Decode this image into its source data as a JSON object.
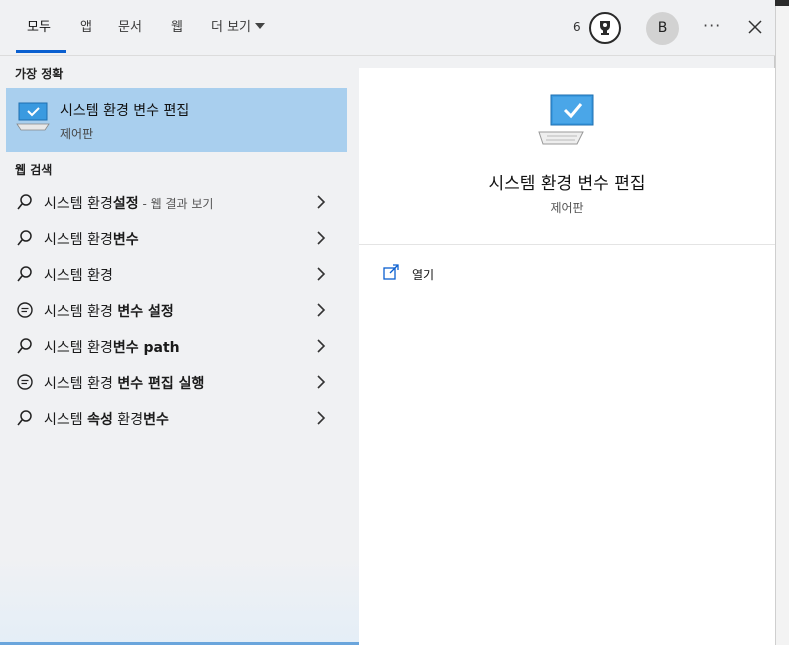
{
  "tabs": [
    {
      "label": "모두"
    },
    {
      "label": "앱"
    },
    {
      "label": "문서"
    },
    {
      "label": "웹"
    },
    {
      "label": "더 보기"
    }
  ],
  "header": {
    "points": "6",
    "avatar_initial": "B",
    "more_label": "···"
  },
  "sections": {
    "best_match": "가장 정확",
    "web_search": "웹 검색"
  },
  "best_match": {
    "title": "시스템 환경 변수 편집",
    "subtitle": "제어판"
  },
  "results": [
    {
      "icon": "search-icon",
      "normal": "시스템 환경",
      "bold": "설정",
      "suffix": " - 웹 결과 보기"
    },
    {
      "icon": "search-icon",
      "normal": "시스템 환경",
      "bold": "변수",
      "suffix": ""
    },
    {
      "icon": "search-icon",
      "normal": "시스템 환경",
      "bold": "",
      "suffix": ""
    },
    {
      "icon": "chat-icon",
      "normal": "시스템 환경 ",
      "bold": "변수 설정",
      "suffix": ""
    },
    {
      "icon": "search-icon",
      "normal": "시스템 환경",
      "bold": "변수 path",
      "suffix": ""
    },
    {
      "icon": "chat-icon",
      "normal": "시스템 환경 ",
      "bold": "변수 편집 실행",
      "suffix": ""
    },
    {
      "icon": "search-icon",
      "normal": "시스템 ",
      "bold": "속성",
      "mid": " 환경",
      "bold2": "변수",
      "suffix": ""
    }
  ],
  "detail": {
    "title": "시스템 환경 변수 편집",
    "subtitle": "제어판",
    "open_label": "열기"
  },
  "colors": {
    "accent": "#0a5fd0",
    "selected_bg": "#a9cfee"
  }
}
